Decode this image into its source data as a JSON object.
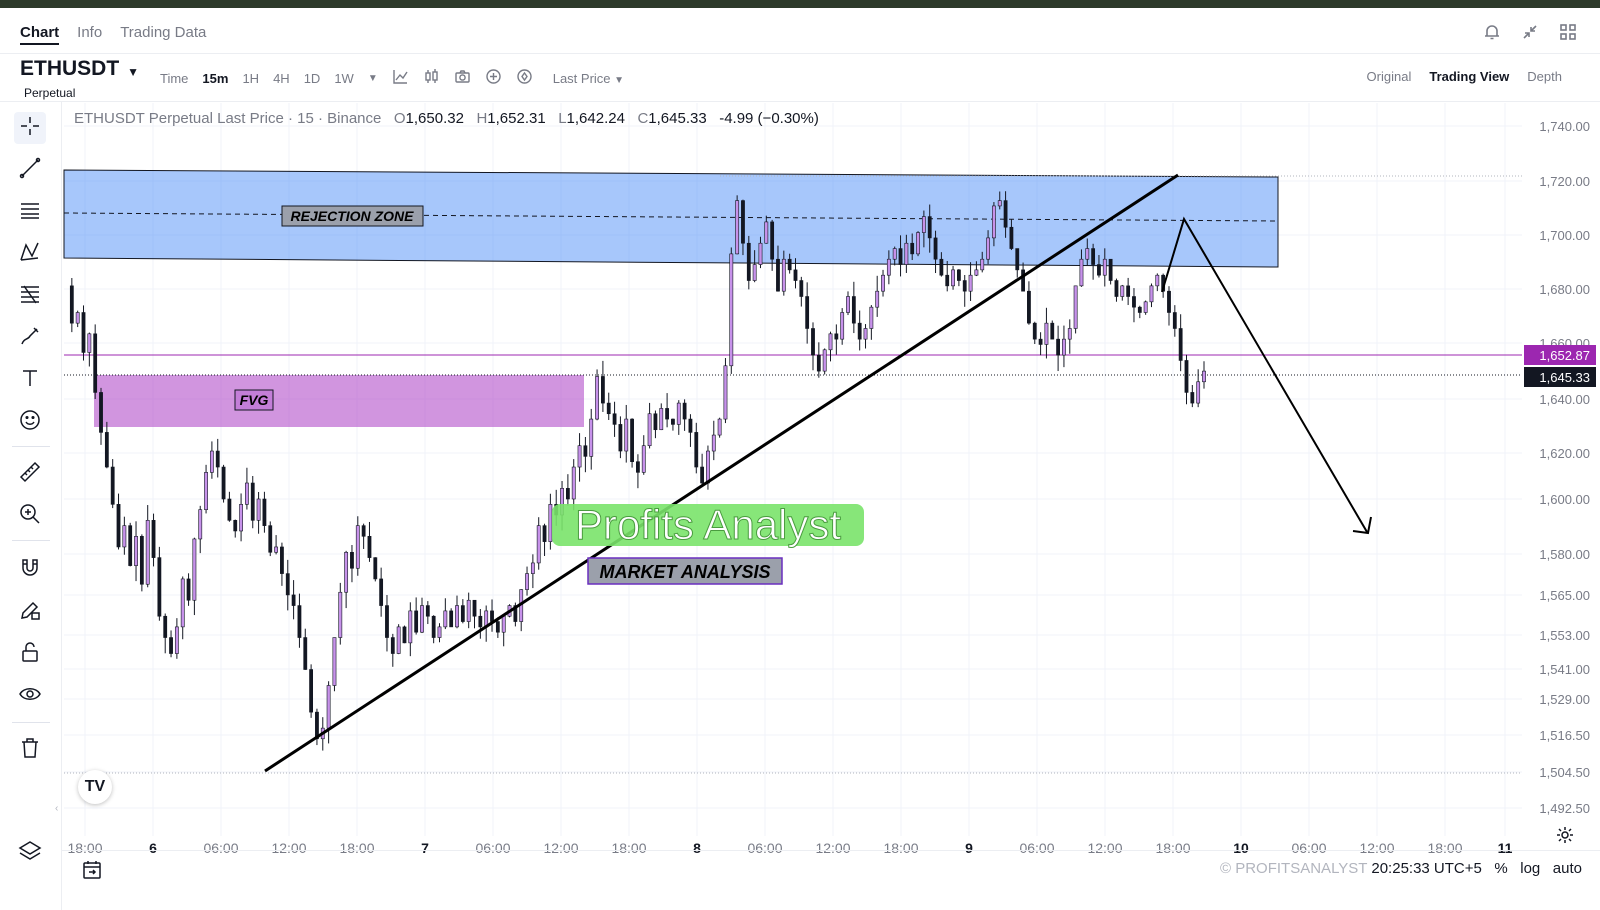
{
  "header": {
    "tabs": [
      {
        "label": "Chart",
        "active": true
      },
      {
        "label": "Info",
        "active": false
      },
      {
        "label": "Trading Data",
        "active": false
      }
    ],
    "icons": [
      "bell-icon",
      "collapse-arrows-icon",
      "grid-layout-icon"
    ]
  },
  "symbol": {
    "name": "ETHUSDT",
    "subtitle": "Perpetual"
  },
  "toolbar": {
    "time_label": "Time",
    "timeframes": [
      "15m",
      "1H",
      "4H",
      "1D",
      "1W"
    ],
    "active_timeframe": "15m",
    "price_source": "Last Price",
    "icons": [
      "chevron-down-icon",
      "indicator-icon",
      "candle-style-icon",
      "camera-icon",
      "add-circle-icon",
      "settings-circle-icon"
    ]
  },
  "view_tabs": [
    {
      "label": "Original",
      "active": false
    },
    {
      "label": "Trading View",
      "active": true
    },
    {
      "label": "Depth",
      "active": false
    }
  ],
  "legend": {
    "title": "ETHUSDT Perpetual Last Price · 15 · Binance",
    "o_label": "O",
    "o": "1,650.32",
    "h_label": "H",
    "h": "1,652.31",
    "l_label": "L",
    "l": "1,642.24",
    "c_label": "C",
    "c": "1,645.33",
    "change": "-4.99 (−0.30%)"
  },
  "left_tools": [
    "crosshair-icon",
    "trendline-icon",
    "horizontal-lines-icon",
    "pattern-icon",
    "fib-icon",
    "brush-icon",
    "text-icon",
    "emoji-icon",
    "ruler-icon",
    "zoom-in-icon",
    "magnet-icon",
    "pencil-lock-icon",
    "unlock-icon",
    "eye-icon",
    "trash-icon"
  ],
  "chart_data": {
    "type": "candlestick",
    "colors": {
      "up": "#c792ea",
      "down": "#131722",
      "wick": "#131722",
      "accent": "#6a2fbf"
    },
    "y_ticks": [
      "1,740.00",
      "1,720.00",
      "1,700.00",
      "1,680.00",
      "1,660.00",
      "1,640.00",
      "1,620.00",
      "1,600.00",
      "1,580.00",
      "1,565.00",
      "1,553.00",
      "1,541.00",
      "1,529.00",
      "1,516.50",
      "1,504.50",
      "1,492.50"
    ],
    "x_ticks": [
      "18:00",
      "6",
      "06:00",
      "12:00",
      "18:00",
      "7",
      "06:00",
      "12:00",
      "18:00",
      "8",
      "06:00",
      "12:00",
      "18:00",
      "9",
      "06:00",
      "12:00",
      "18:00",
      "10",
      "06:00",
      "12:00",
      "18:00",
      "11"
    ],
    "price_tags": {
      "marked_line": {
        "value": "1,652.87",
        "color": "#9c27b0"
      },
      "last": {
        "value": "1,645.33",
        "color": "#131722"
      }
    },
    "price_path": [
      1680,
      1666,
      1670,
      1655,
      1662,
      1640,
      1625,
      1612,
      1598,
      1582,
      1590,
      1575,
      1586,
      1568,
      1592,
      1578,
      1556,
      1548,
      1542,
      1552,
      1570,
      1562,
      1585,
      1596,
      1610,
      1618,
      1612,
      1600,
      1592,
      1588,
      1598,
      1606,
      1592,
      1600,
      1590,
      1580,
      1582,
      1572,
      1564,
      1560,
      1548,
      1536,
      1520,
      1510,
      1514,
      1530,
      1548,
      1565,
      1580,
      1574,
      1590,
      1586,
      1578,
      1570,
      1560,
      1548,
      1542,
      1552,
      1546,
      1558,
      1550,
      1560,
      1556,
      1548,
      1552,
      1558,
      1552,
      1560,
      1554,
      1562,
      1556,
      1552,
      1558,
      1554,
      1550,
      1556,
      1560,
      1554,
      1566,
      1572,
      1576,
      1590,
      1584,
      1598,
      1594,
      1604,
      1600,
      1612,
      1620,
      1616,
      1630,
      1646,
      1636,
      1632,
      1628,
      1618,
      1630,
      1614,
      1610,
      1620,
      1632,
      1626,
      1634,
      1630,
      1628,
      1636,
      1630,
      1625,
      1612,
      1606,
      1618,
      1624,
      1630,
      1650,
      1692,
      1712,
      1696,
      1682,
      1688,
      1696,
      1704,
      1690,
      1678,
      1690,
      1686,
      1682,
      1676,
      1664,
      1654,
      1648,
      1656,
      1662,
      1660,
      1670,
      1676,
      1666,
      1660,
      1664,
      1672,
      1678,
      1684,
      1690,
      1694,
      1688,
      1696,
      1692,
      1700,
      1706,
      1698,
      1690,
      1684,
      1680,
      1686,
      1682,
      1678,
      1684,
      1686,
      1690,
      1698,
      1710,
      1712,
      1702,
      1694,
      1686,
      1678,
      1666,
      1660,
      1658,
      1666,
      1660,
      1654,
      1660,
      1664,
      1680,
      1690,
      1694,
      1688,
      1684,
      1690,
      1682,
      1676,
      1680,
      1676,
      1672,
      1670,
      1674,
      1680,
      1684,
      1678,
      1670,
      1664,
      1652,
      1640,
      1636,
      1644,
      1648
    ],
    "drawings": {
      "rejection_zone_label": "REJECTION ZONE",
      "fvg_label": "FVG",
      "market_analysis_label": "MARKET ANALYSIS",
      "watermark_text": "Profits Analyst"
    }
  },
  "status": {
    "time": "20:25:33 UTC+5",
    "percent": "%",
    "log": "log",
    "auto": "auto",
    "watermark": "© PROFITSANALYST"
  }
}
